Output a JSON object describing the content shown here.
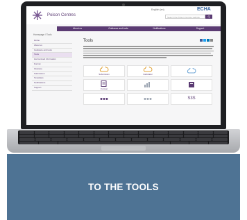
{
  "banner": {
    "label": "TO THE TOOLS"
  },
  "screen": {
    "site_title": "Poison Centres",
    "language": "English (en)",
    "brand": "ECHA",
    "search_placeholder": "Search the Poison Centres website",
    "search_button": "Q",
    "nav": [
      "About us",
      "Guidance and tools",
      "Notifications",
      "Support"
    ],
    "breadcrumb": "Homepage / Tools",
    "sidebar": [
      "Home",
      "About us",
      "Guidance and tools",
      "Tools",
      "Harmonised information",
      "Format",
      "Glossary",
      "Submission",
      "Templates",
      "Notifications",
      "Support"
    ],
    "page_title": "Tools",
    "tools": [
      {
        "label": "Submission",
        "icon": "cloud-icon"
      },
      {
        "label": "Calculator",
        "icon": "cloud-icon"
      },
      {
        "label": "",
        "icon": "cloud-icon"
      },
      {
        "label": "Format",
        "icon": "document-icon"
      },
      {
        "label": "",
        "icon": "bars-icon"
      },
      {
        "label": "",
        "icon": "bars-icon"
      },
      {
        "label": "",
        "icon": "dots-icon"
      },
      {
        "label": "",
        "icon": "dots-icon"
      },
      {
        "label": "S3S",
        "icon": "s3s-icon"
      }
    ]
  }
}
